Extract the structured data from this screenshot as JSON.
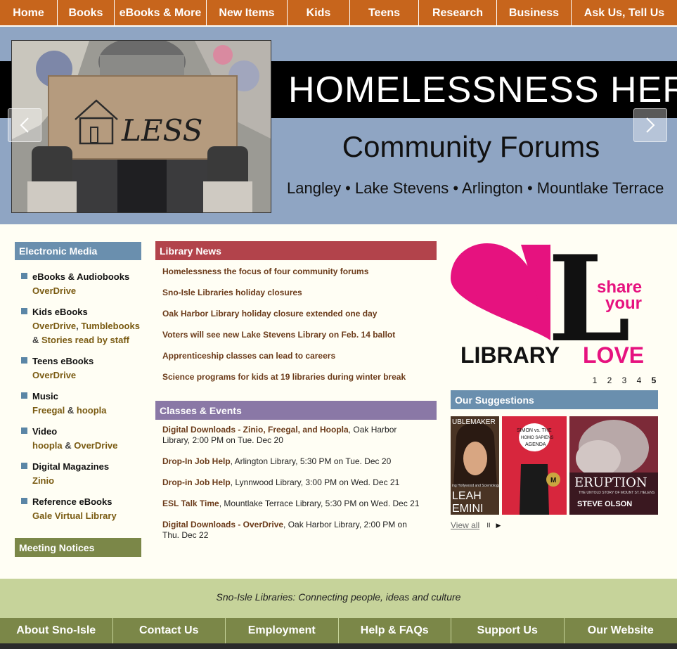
{
  "topnav": [
    "Home",
    "Books",
    "eBooks & More",
    "New Items",
    "Kids",
    "Teens",
    "Research",
    "Business",
    "Ask Us, Tell Us"
  ],
  "hero": {
    "title": "HOMELESSNESS HERE",
    "subtitle": "Community Forums",
    "places": "Langley • Lake Stevens • Arlington • Mountlake Terrace",
    "sign_text": "LESS"
  },
  "electronic_media": {
    "heading": "Electronic Media",
    "items": [
      {
        "name": "eBooks & Audiobooks",
        "links": [
          "OverDrive"
        ]
      },
      {
        "name": "Kids eBooks",
        "links": [
          "OverDrive",
          "Tumblebooks",
          "Stories read by staff"
        ]
      },
      {
        "name": "Teens eBooks",
        "links": [
          "OverDrive"
        ]
      },
      {
        "name": "Music",
        "links": [
          "Freegal",
          "hoopla"
        ]
      },
      {
        "name": "Video",
        "links": [
          "hoopla",
          "OverDrive"
        ]
      },
      {
        "name": "Digital Magazines",
        "links": [
          "Zinio"
        ]
      },
      {
        "name": "Reference eBooks",
        "links": [
          "Gale Virtual Library"
        ]
      }
    ]
  },
  "meeting_notices": {
    "heading": "Meeting Notices"
  },
  "library_news": {
    "heading": "Library News",
    "items": [
      "Homelessness the focus of four community forums",
      "Sno-Isle Libraries holiday closures",
      "Oak Harbor Library holiday closure extended one day",
      "Voters will see new Lake Stevens Library on Feb. 14 ballot",
      "Apprenticeship classes can lead to careers",
      "Science programs for kids at 19 libraries during winter break"
    ]
  },
  "classes_events": {
    "heading": "Classes & Events",
    "items": [
      {
        "title": "Digital Downloads - Zinio, Freegal, and Hoopla",
        "detail": ", Oak Harbor Library, 2:00 PM on Tue. Dec 20"
      },
      {
        "title": "Drop-In Job Help",
        "detail": ", Arlington Library, 5:30 PM on Tue. Dec 20"
      },
      {
        "title": "Drop-in Job Help",
        "detail": ", Lynnwood Library, 3:00 PM on Wed. Dec 21"
      },
      {
        "title": "ESL Talk Time",
        "detail": ", Mountlake Terrace Library, 5:30 PM on Wed. Dec 21"
      },
      {
        "title": "Digital Downloads - OverDrive",
        "detail": ", Oak Harbor Library, 2:00 PM on Thu. Dec 22"
      }
    ]
  },
  "promo": {
    "share_line1": "share",
    "share_line2": "your",
    "big_letter": "L",
    "library": "LIBRARY",
    "love": "LOVE"
  },
  "slides": [
    "1",
    "2",
    "3",
    "4",
    "5"
  ],
  "suggestions": {
    "heading": "Our Suggestions",
    "covers": [
      {
        "top": "UBLEMAKER",
        "line1": "LEAH",
        "line2": "EMINI",
        "blurb": "ing Hollywood and Scientology"
      },
      {
        "top": "SIMON vs. THE",
        "line1": "HOMO SAPIENS",
        "line2": "AGENDA",
        "badge": "M"
      },
      {
        "top": "",
        "line1": "ERUPTION",
        "line2": "STEVE OLSON",
        "blurb": "THE UNTOLD STORY OF MOUNT ST. HELENS"
      }
    ],
    "view_all": "View all",
    "pause": "II",
    "play": "▶"
  },
  "footer": {
    "tagline": "Sno-Isle Libraries: Connecting people, ideas and culture",
    "nav": [
      "About Sno-Isle",
      "Contact Us",
      "Employment",
      "Help & FAQs",
      "Support Us",
      "Our Website"
    ]
  },
  "colors": {
    "nav_orange": "#c7651c",
    "hero_blue": "#8fa5c3",
    "media_blue": "#6a8fae",
    "news_red": "#b2434b",
    "events_purple": "#8a78a6",
    "meeting_green": "#7b8748",
    "footer_green": "#c6d39a",
    "love_pink": "#e6127f"
  }
}
